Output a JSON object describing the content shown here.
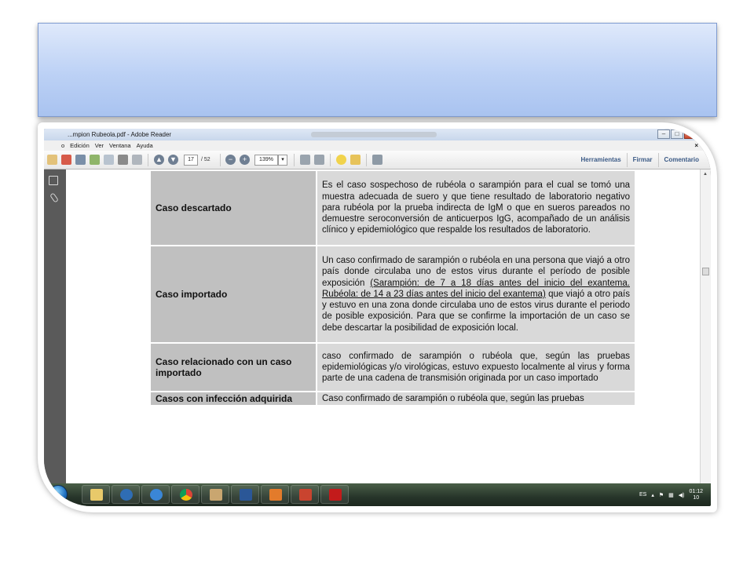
{
  "window": {
    "title": "...mpion Rubeola.pdf - Adobe Reader",
    "controls": {
      "minimize": "–",
      "maximize": "□",
      "close": "✕"
    }
  },
  "menu": {
    "items": [
      "o",
      "Edición",
      "Ver",
      "Ventana",
      "Ayuda"
    ],
    "close_doc": "×"
  },
  "toolbar": {
    "page_current": "17",
    "page_total": "/ 52",
    "zoom": "139%",
    "right_tabs": [
      "Herramientas",
      "Firmar",
      "Comentario"
    ]
  },
  "table": {
    "rows": [
      {
        "term": "Caso descartado",
        "definition": "Es el caso sospechoso de rubéola o sarampión  para el cual se tomó una muestra adecuada de suero y que tiene resultado de laboratorio negativo para rubéola por la prueba indirecta de IgM o que en sueros pareados no demuestre seroconversión de anticuerpos IgG, acompañado de un análisis clínico y epidemiológico que respalde los resultados de laboratorio."
      },
      {
        "term": "Caso importado",
        "definition_a": "Un caso confirmado de sarampión o rubéola en una persona que viajó a otro país donde circulaba uno de estos virus durante el período de posible exposición ",
        "definition_underlined": "(Sarampión: de 7 a 18 días antes del inicio del exantema. Rubéola: de 14 a 23 días antes del inicio del exantema)",
        "definition_b": " que viajó a otro país y estuvo en una zona donde circulaba uno de estos virus durante el periodo de posible exposición. Para que se confirme la importación de un caso se debe descartar la posibilidad de exposición local."
      },
      {
        "term": "Caso relacionado con un caso importado",
        "definition": "caso confirmado de sarampión o rubéola que, según las pruebas epidemiológicas y/o virológicas, estuvo expuesto localmente al virus  y forma parte de una cadena de transmisión originada por un caso importado"
      },
      {
        "term": "Casos con infección adquirida",
        "definition": "Caso confirmado de sarampión o rubéola que, según las pruebas"
      }
    ]
  },
  "taskbar": {
    "language": "ES",
    "time": "01:12",
    "date": "10"
  },
  "colors": {
    "header_top": "#dfe9fb",
    "header_bottom": "#a9c3f0",
    "term_cell": "#c0c0c0",
    "definition_cell": "#d9d9d9",
    "toolbar_link": "#3b5a86"
  }
}
